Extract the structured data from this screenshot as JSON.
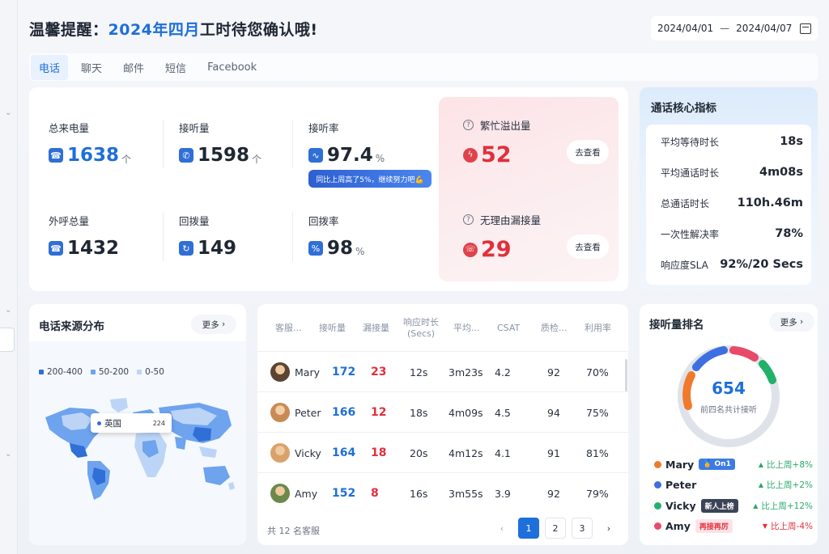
{
  "header": {
    "title_prefix": "温馨提醒：",
    "title_highlight": "2024年四月",
    "title_suffix": "工时待您确认哦!",
    "date_start": "2024/04/01",
    "date_sep": "—",
    "date_end": "2024/04/07"
  },
  "tabs": [
    {
      "label": "电话",
      "active": true
    },
    {
      "label": "聊天"
    },
    {
      "label": "邮件"
    },
    {
      "label": "短信"
    },
    {
      "label": "Facebook"
    }
  ],
  "metrics": {
    "total_calls": {
      "label": "总来电量",
      "value": "1638",
      "unit": "个"
    },
    "answered": {
      "label": "接听量",
      "value": "1598",
      "unit": "个"
    },
    "answer_rate": {
      "label": "接听率",
      "value": "97.4",
      "unit": "%"
    },
    "outbound": {
      "label": "外呼总量",
      "value": "1432"
    },
    "callback": {
      "label": "回拨量",
      "value": "149"
    },
    "callback_rate": {
      "label": "回拨率",
      "value": "98",
      "unit": "%"
    },
    "tip": "同比上周高了5%，继续努力吧💪"
  },
  "alerts": {
    "overflow": {
      "label": "繁忙溢出量",
      "value": "52",
      "button": "去查看"
    },
    "missed": {
      "label": "无理由漏接量",
      "value": "29",
      "button": "去查看"
    }
  },
  "core": {
    "title": "通话核心指标",
    "rows": [
      {
        "k": "平均等待时长",
        "v": "18s"
      },
      {
        "k": "平均通话时长",
        "v": "4m08s"
      },
      {
        "k": "总通话时长",
        "v": "110h.46m"
      },
      {
        "k": "一次性解决率",
        "v": "78%"
      },
      {
        "k": "响应度SLA",
        "v": "92%/20 Secs"
      }
    ]
  },
  "source": {
    "title": "电话来源分布",
    "more": "更多",
    "legend": [
      {
        "label": "200-400",
        "color": "#2f6fd6"
      },
      {
        "label": "50-200",
        "color": "#6ea3ee"
      },
      {
        "label": "0-50",
        "color": "#bcd5f7"
      }
    ],
    "tooltip": {
      "country": "英国",
      "count": "224"
    }
  },
  "agents": {
    "headers": [
      "客服...",
      "接听量",
      "漏接量",
      "响应时长",
      "(Secs)",
      "平均...",
      "CSAT",
      "质检...",
      "利用率"
    ],
    "rows": [
      {
        "name": "Mary",
        "answered": "172",
        "missed": "23",
        "resp": "12s",
        "avg": "3m23s",
        "csat": "4.2",
        "qa": "92",
        "util": "70%"
      },
      {
        "name": "Peter",
        "answered": "166",
        "missed": "12",
        "resp": "18s",
        "avg": "4m09s",
        "csat": "4.5",
        "qa": "94",
        "util": "75%"
      },
      {
        "name": "Vicky",
        "answered": "164",
        "missed": "18",
        "resp": "20s",
        "avg": "4m12s",
        "csat": "4.1",
        "qa": "91",
        "util": "81%"
      },
      {
        "name": "Amy",
        "answered": "152",
        "missed": "8",
        "resp": "16s",
        "avg": "3m55s",
        "csat": "3.9",
        "qa": "92",
        "util": "79%"
      }
    ],
    "footer": "共 12 名客服",
    "pages": [
      "1",
      "2",
      "3"
    ]
  },
  "ranking": {
    "title": "接听量排名",
    "more": "更多",
    "total": "654",
    "total_label": "前四名共计接听",
    "rows": [
      {
        "name": "Mary",
        "color": "#f07a2c",
        "tag": "On1",
        "tag_bg": "#3d7be4",
        "tag_fg": "#ffffff",
        "trend": "比上周+8%",
        "trend_color": "#2aa86b",
        "dir": "up"
      },
      {
        "name": "Peter",
        "color": "#3d6fe0",
        "tag": "",
        "trend": "比上周+2%",
        "trend_color": "#2aa86b",
        "dir": "up"
      },
      {
        "name": "Vicky",
        "color": "#22b16a",
        "tag": "新人上榜",
        "tag_bg": "#3b4456",
        "tag_fg": "#ffffff",
        "trend": "比上周+12%",
        "trend_color": "#2aa86b",
        "dir": "up"
      },
      {
        "name": "Amy",
        "color": "#e84a6a",
        "tag": "再接再厉",
        "tag_bg": "#fde3e8",
        "tag_fg": "#e0303b",
        "trend": "比上周-4%",
        "trend_color": "#e0303b",
        "dir": "down"
      }
    ]
  }
}
